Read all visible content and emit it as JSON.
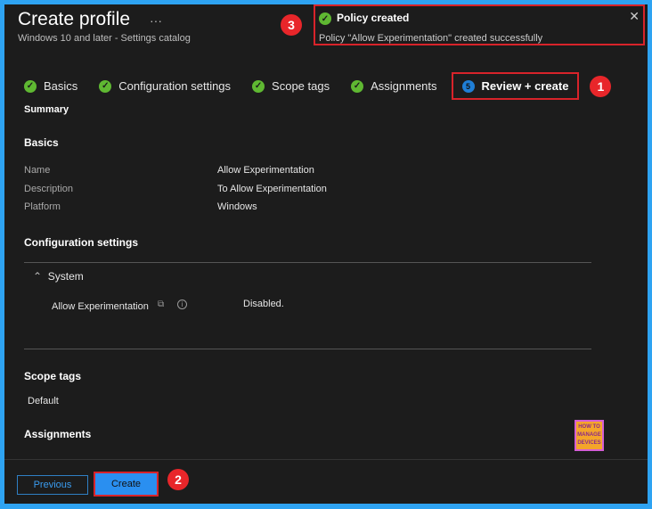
{
  "header": {
    "title": "Create profile",
    "more": "···",
    "subtitle": "Windows 10 and later - Settings catalog"
  },
  "toast": {
    "title": "Policy created",
    "message": "Policy \"Allow Experimentation\" created successfully",
    "close": "✕"
  },
  "steps": [
    {
      "label": "Basics"
    },
    {
      "label": "Configuration settings"
    },
    {
      "label": "Scope tags"
    },
    {
      "label": "Assignments"
    },
    {
      "label": "Review + create",
      "number": "5"
    }
  ],
  "annotations": {
    "one": "1",
    "two": "2",
    "three": "3"
  },
  "summary": "Summary",
  "basics": {
    "heading": "Basics",
    "rows": [
      {
        "label": "Name",
        "value": "Allow Experimentation"
      },
      {
        "label": "Description",
        "value": "To Allow Experimentation"
      },
      {
        "label": "Platform",
        "value": "Windows"
      }
    ]
  },
  "config": {
    "heading": "Configuration settings",
    "group": "System",
    "setting": "Allow Experimentation",
    "value": "Disabled."
  },
  "scope": {
    "heading": "Scope tags",
    "value": "Default"
  },
  "assignments": {
    "heading": "Assignments"
  },
  "footer": {
    "previous": "Previous",
    "create": "Create"
  },
  "logo": {
    "line1": "HOW TO",
    "line2": "MANAGE",
    "line3": "DEVICES"
  }
}
